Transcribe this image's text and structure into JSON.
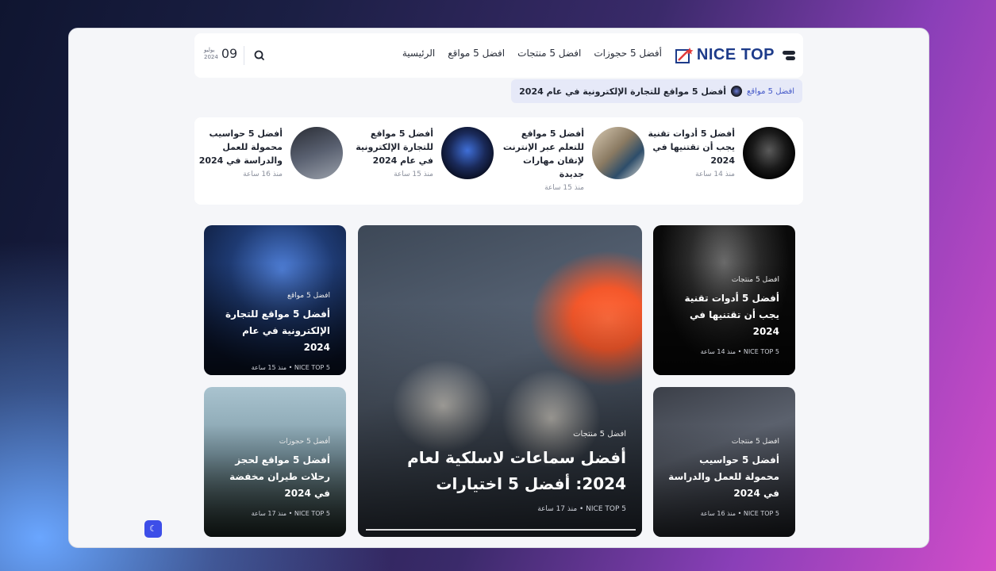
{
  "header": {
    "logo_text": "NICE TOP",
    "nav": [
      "الرئيسية",
      "افضل 5 مواقع",
      "افضل 5 منتجات",
      "أفضل 5 حجوزات"
    ],
    "date_day": "09",
    "date_month": "يوليو",
    "date_year": "2024"
  },
  "ticker": {
    "category": "افضل 5 مواقع",
    "title": "أفضل 5 مواقع للتجارة الإلكترونية في عام 2024"
  },
  "strip": [
    {
      "title": "أفضل 5 أدوات تقنية يجب أن تقتنيها في 2024",
      "meta": "منذ 14 ساعة"
    },
    {
      "title": "أفضل 5 مواقع للتعلم عبر الإنترنت لإتقان مهارات جديدة",
      "meta": "منذ 15 ساعة"
    },
    {
      "title": "أفضل 5 مواقع للتجارة الإلكترونية في عام 2024",
      "meta": "منذ 15 ساعة"
    },
    {
      "title": "أفضل 5 حواسيب محمولة للعمل والدراسة في 2024",
      "meta": "منذ 16 ساعة"
    }
  ],
  "cards": {
    "right_top": {
      "category": "افضل 5 منتجات",
      "title": "أفضل 5 أدوات تقنية يجب أن تقتنيها في 2024",
      "meta": "NICE TOP 5 • منذ 14 ساعة"
    },
    "right_bottom": {
      "category": "افضل 5 منتجات",
      "title": "أفضل 5 حواسيب محمولة للعمل والدراسة في 2024",
      "meta": "NICE TOP 5 • منذ 16 ساعة"
    },
    "center": {
      "category": "افضل 5 منتجات",
      "title": "أفضل سماعات لاسلكية لعام 2024: أفضل 5 اختيارات",
      "meta": "NICE TOP 5 • منذ 17 ساعة"
    },
    "left_top": {
      "category": "افضل 5 مواقع",
      "title": "أفضل 5 مواقع للتجارة الإلكترونية في عام 2024",
      "meta": "NICE TOP 5 • منذ 15 ساعة"
    },
    "left_bottom": {
      "category": "أفضل 5 حجوزات",
      "title": "أفضل 5 مواقع لحجز رحلات طيران مخفضة في 2024",
      "meta": "NICE TOP 5 • منذ 17 ساعة"
    }
  },
  "dark_mode_icon": "moon-icon"
}
